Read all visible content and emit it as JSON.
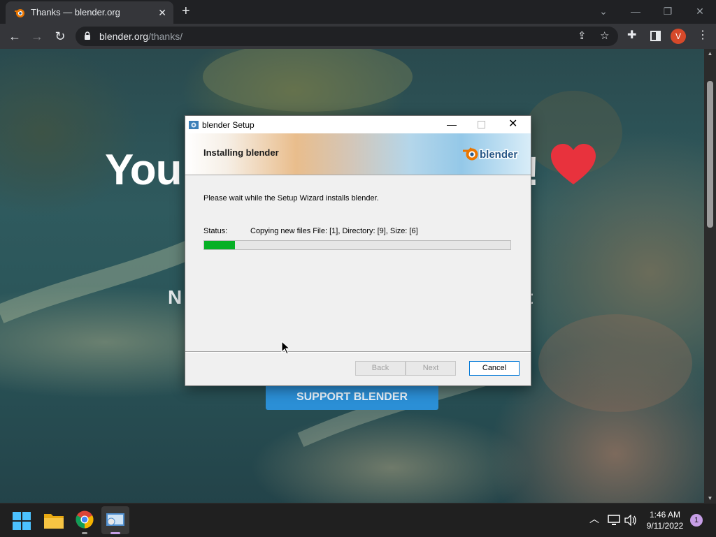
{
  "browser": {
    "tab_title": "Thanks — blender.org",
    "tab_close": "✕",
    "new_tab": "+",
    "url_domain": "blender.org",
    "url_path": "/thanks/",
    "profile_initial": "V",
    "controls": {
      "dropdown": "⌄",
      "minimize": "—",
      "restore": "❐",
      "close": "✕"
    }
  },
  "page": {
    "hero_left": "You",
    "hero_right": "!",
    "sub_left": "N",
    "sub_right": "t",
    "support_button": "SUPPORT BLENDER",
    "heart_color": "#e8323d"
  },
  "dialog": {
    "title": "blender Setup",
    "banner_title": "Installing blender",
    "logo_text": "blender",
    "intro": "Please wait while the Setup Wizard installs blender.",
    "status_label": "Status:",
    "status_text": "Copying new files File: [1],  Directory: [9],  Size: [6]",
    "progress_fraction": 0.1,
    "progress_color": "#06b025",
    "buttons": {
      "back": "Back",
      "next": "Next",
      "cancel": "Cancel"
    }
  },
  "taskbar": {
    "time": "1:46 AM",
    "date": "9/11/2022",
    "notification_count": "1"
  },
  "colors": {
    "chrome_dark": "#202124",
    "chrome_toolbar": "#35363a",
    "support_blue": "#2b8fd6",
    "profile_orange": "#d6492a"
  }
}
